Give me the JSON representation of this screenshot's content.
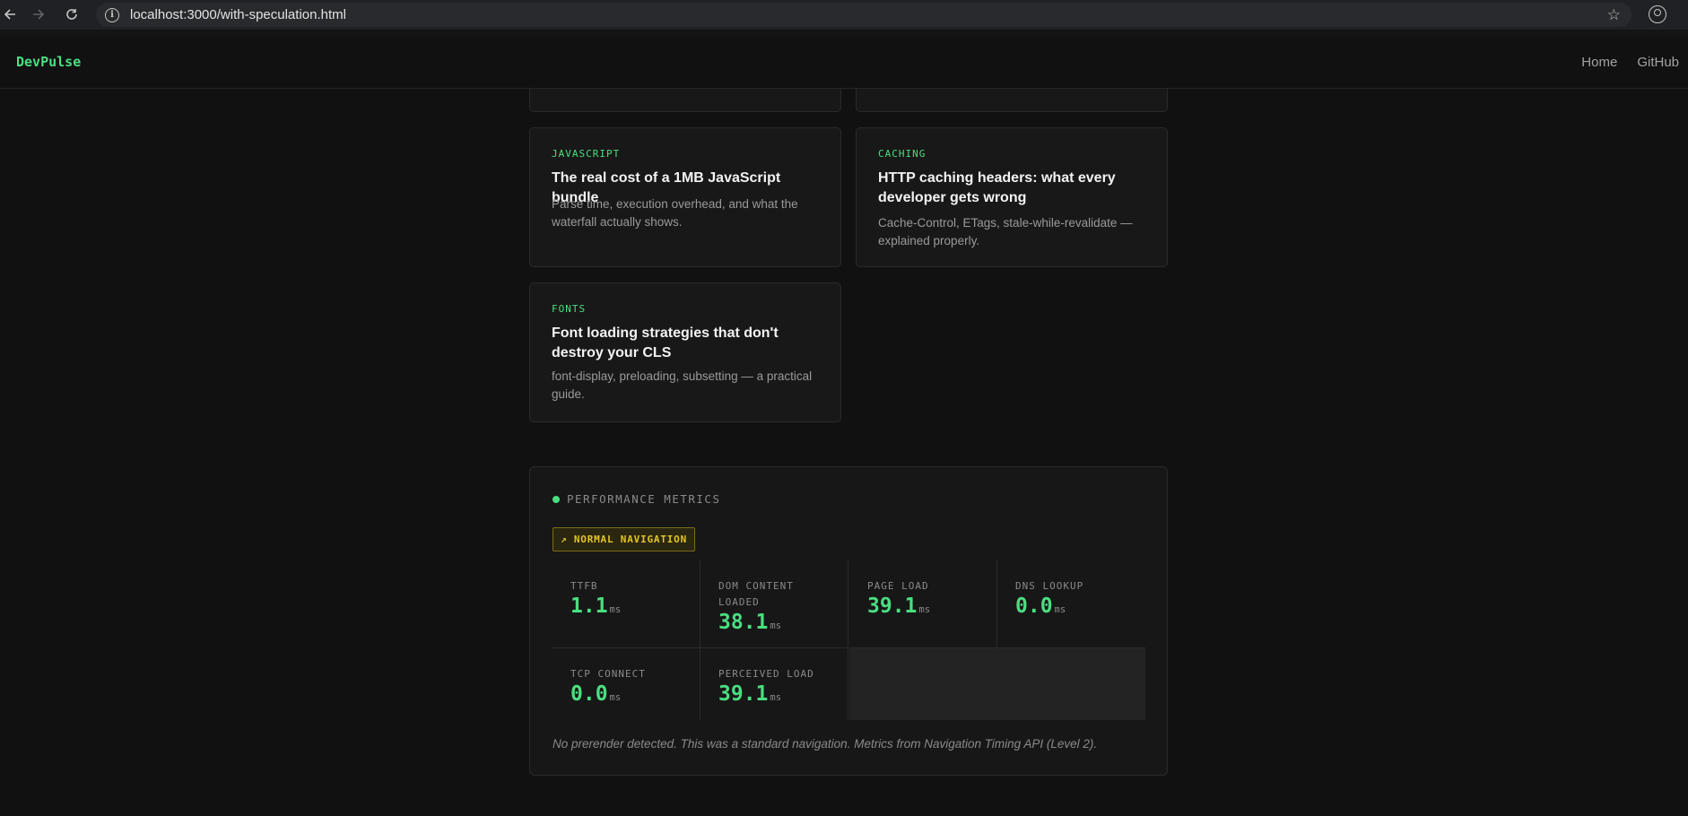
{
  "browser": {
    "url": "localhost:3000/with-speculation.html",
    "back_icon": "arrow-left-icon",
    "forward_icon": "arrow-right-icon",
    "reload_icon": "reload-icon",
    "star_icon": "star-icon",
    "profile_icon": "profile-icon"
  },
  "site": {
    "brand": "DevPulse",
    "nav": [
      "Home",
      "GitHub"
    ]
  },
  "articles": [
    {
      "tag": "JAVASCRIPT",
      "title": "The real cost of a 1MB JavaScript bundle",
      "desc": "Parse time, execution overhead, and what the waterfall actually shows."
    },
    {
      "tag": "CACHING",
      "title": "HTTP caching headers: what every developer gets wrong",
      "desc": "Cache-Control, ETags, stale-while-revalidate — explained properly."
    },
    {
      "tag": "FONTS",
      "title": "Font loading strategies that don't destroy your CLS",
      "desc": "font-display, preloading, subsetting — a practical guide."
    }
  ],
  "metrics": {
    "title": "PERFORMANCE METRICS",
    "badge": "↗ NORMAL NAVIGATION",
    "items": [
      {
        "label": "TTFB",
        "value": "1.1",
        "unit": "ms"
      },
      {
        "label": "DOM CONTENT LOADED",
        "value": "38.1",
        "unit": "ms"
      },
      {
        "label": "PAGE LOAD",
        "value": "39.1",
        "unit": "ms"
      },
      {
        "label": "DNS LOOKUP",
        "value": "0.0",
        "unit": "ms"
      },
      {
        "label": "TCP CONNECT",
        "value": "0.0",
        "unit": "ms"
      },
      {
        "label": "PERCEIVED LOAD",
        "value": "39.1",
        "unit": "ms"
      }
    ],
    "note": "No prerender detected. This was a standard navigation. Metrics from Navigation Timing API (Level 2)."
  },
  "colors": {
    "accent": "#4ade80",
    "badge": "#e3c620",
    "background": "#111111",
    "card": "#181818"
  }
}
